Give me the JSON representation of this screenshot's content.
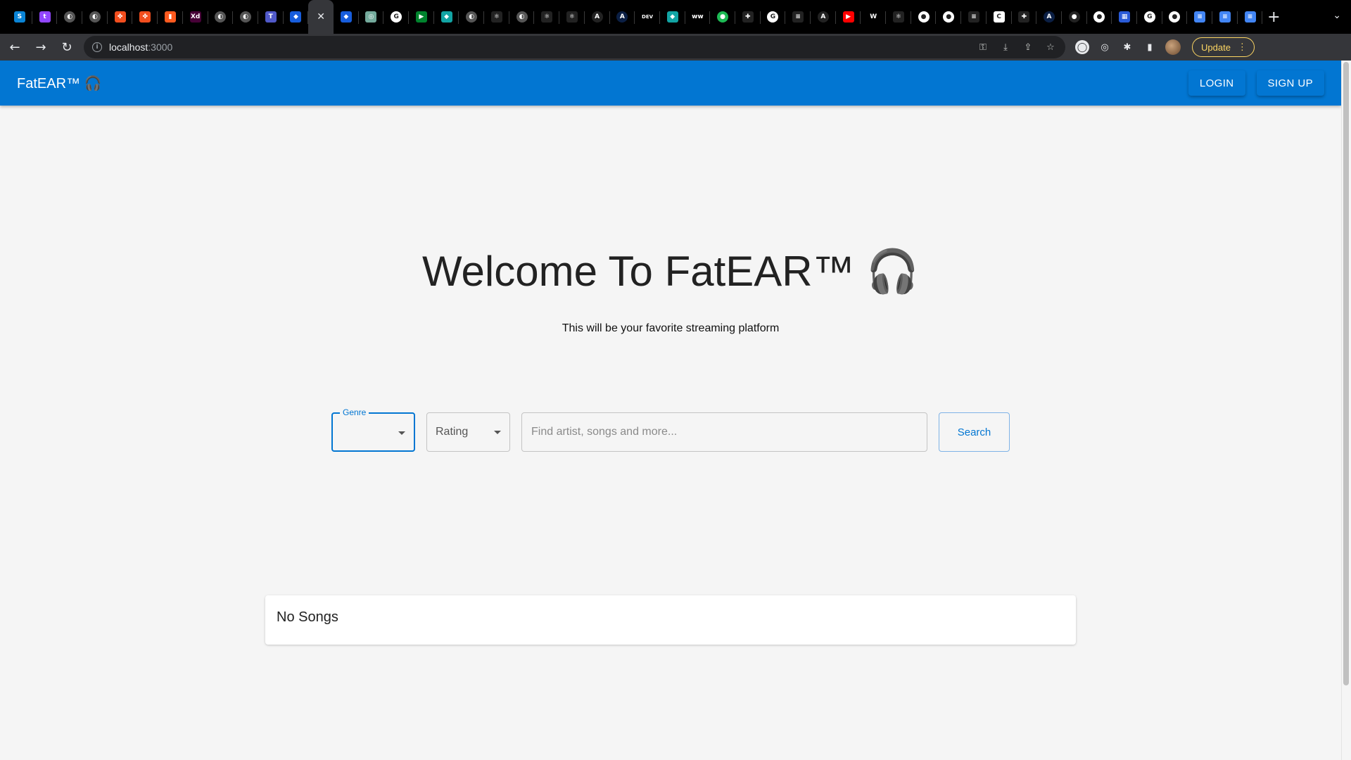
{
  "browser": {
    "tabs": [
      {
        "icon": "skype-icon",
        "glyph": "S",
        "color": "#0a84d6"
      },
      {
        "icon": "twitch-icon",
        "glyph": "t",
        "color": "#9146ff"
      },
      {
        "icon": "globe-icon",
        "glyph": "◐",
        "color": "#555"
      },
      {
        "icon": "globe-icon",
        "glyph": "◐",
        "color": "#555"
      },
      {
        "icon": "figma-icon",
        "glyph": "✤",
        "color": "#f24e1e"
      },
      {
        "icon": "figma-icon",
        "glyph": "✤",
        "color": "#f24e1e"
      },
      {
        "icon": "trello-icon",
        "glyph": "▮",
        "color": "#ff5a1f"
      },
      {
        "icon": "adobe-xd-icon",
        "glyph": "Xd",
        "color": "#470137"
      },
      {
        "icon": "globe-icon",
        "glyph": "◐",
        "color": "#555"
      },
      {
        "icon": "globe-icon",
        "glyph": "◐",
        "color": "#555"
      },
      {
        "icon": "teams-icon",
        "glyph": "T",
        "color": "#5059c9"
      },
      {
        "icon": "bitwarden-icon",
        "glyph": "◆",
        "color": "#175ddc"
      },
      {
        "icon": "close-icon",
        "glyph": "✕",
        "color": "transparent",
        "active": true
      },
      {
        "icon": "bitwarden-icon",
        "glyph": "◆",
        "color": "#175ddc"
      },
      {
        "icon": "chatgpt-icon",
        "glyph": "◎",
        "color": "#74aa9c"
      },
      {
        "icon": "google-icon",
        "glyph": "G",
        "color": "#fff"
      },
      {
        "icon": "meet-icon",
        "glyph": "▶",
        "color": "#00832d"
      },
      {
        "icon": "diamond-icon",
        "glyph": "◆",
        "color": "#12a4a4"
      },
      {
        "icon": "globe-icon",
        "glyph": "◐",
        "color": "#555"
      },
      {
        "icon": "react-icon",
        "glyph": "⚛",
        "color": "#222"
      },
      {
        "icon": "globe-icon",
        "glyph": "◐",
        "color": "#555"
      },
      {
        "icon": "react-icon",
        "glyph": "⚛",
        "color": "#222"
      },
      {
        "icon": "react-icon",
        "glyph": "⚛",
        "color": "#222"
      },
      {
        "icon": "apollo-icon",
        "glyph": "A",
        "color": "#222"
      },
      {
        "icon": "apollo-icon",
        "glyph": "A",
        "color": "#0b1f44"
      },
      {
        "icon": "dev-icon",
        "glyph": "DEV",
        "color": "#000"
      },
      {
        "icon": "diamond-icon",
        "glyph": "◆",
        "color": "#12a4a4"
      },
      {
        "icon": "ww-icon",
        "glyph": "ww",
        "color": "#000"
      },
      {
        "icon": "spotify-icon",
        "glyph": "●",
        "color": "#1db954"
      },
      {
        "icon": "slack-icon",
        "glyph": "✚",
        "color": "#222"
      },
      {
        "icon": "google-icon",
        "glyph": "G",
        "color": "#fff"
      },
      {
        "icon": "stack-icon",
        "glyph": "≡",
        "color": "#222"
      },
      {
        "icon": "apollo-icon",
        "glyph": "A",
        "color": "#222"
      },
      {
        "icon": "youtube-icon",
        "glyph": "▶",
        "color": "#ff0000"
      },
      {
        "icon": "webflow-icon",
        "glyph": "W",
        "color": "#000"
      },
      {
        "icon": "react-icon",
        "glyph": "⚛",
        "color": "#222"
      },
      {
        "icon": "github-icon",
        "glyph": "●",
        "color": "#fff"
      },
      {
        "icon": "github-icon",
        "glyph": "●",
        "color": "#fff"
      },
      {
        "icon": "stack-icon",
        "glyph": "≡",
        "color": "#222"
      },
      {
        "icon": "c-icon",
        "glyph": "C",
        "color": "#fff"
      },
      {
        "icon": "slack-icon",
        "glyph": "✚",
        "color": "#222"
      },
      {
        "icon": "apollo-icon",
        "glyph": "A",
        "color": "#0b1f44"
      },
      {
        "icon": "record-icon",
        "glyph": "●",
        "color": "#222"
      },
      {
        "icon": "github-icon",
        "glyph": "●",
        "color": "#fff"
      },
      {
        "icon": "grid-icon",
        "glyph": "▦",
        "color": "#2a5bd7"
      },
      {
        "icon": "google-icon",
        "glyph": "G",
        "color": "#fff"
      },
      {
        "icon": "github-icon",
        "glyph": "●",
        "color": "#fff"
      },
      {
        "icon": "docs-icon",
        "glyph": "≡",
        "color": "#4285f4"
      },
      {
        "icon": "docs-icon",
        "glyph": "≡",
        "color": "#4285f4"
      },
      {
        "icon": "docs-icon",
        "glyph": "≡",
        "color": "#4285f4"
      }
    ],
    "url_host": "localhost",
    "url_port": ":3000",
    "update_label": "Update"
  },
  "app": {
    "brand": "FatEAR™ 🎧",
    "login_label": "LOGIN",
    "signup_label": "SIGN UP",
    "accent": "#0276d2"
  },
  "hero": {
    "title": "Welcome To FatEAR™ 🎧",
    "subtitle": "This will be your favorite streaming platform"
  },
  "search": {
    "genre_label": "Genre",
    "rating_label": "Rating",
    "placeholder": "Find artist, songs and more...",
    "button_label": "Search"
  },
  "results": {
    "empty_text": "No Songs"
  }
}
